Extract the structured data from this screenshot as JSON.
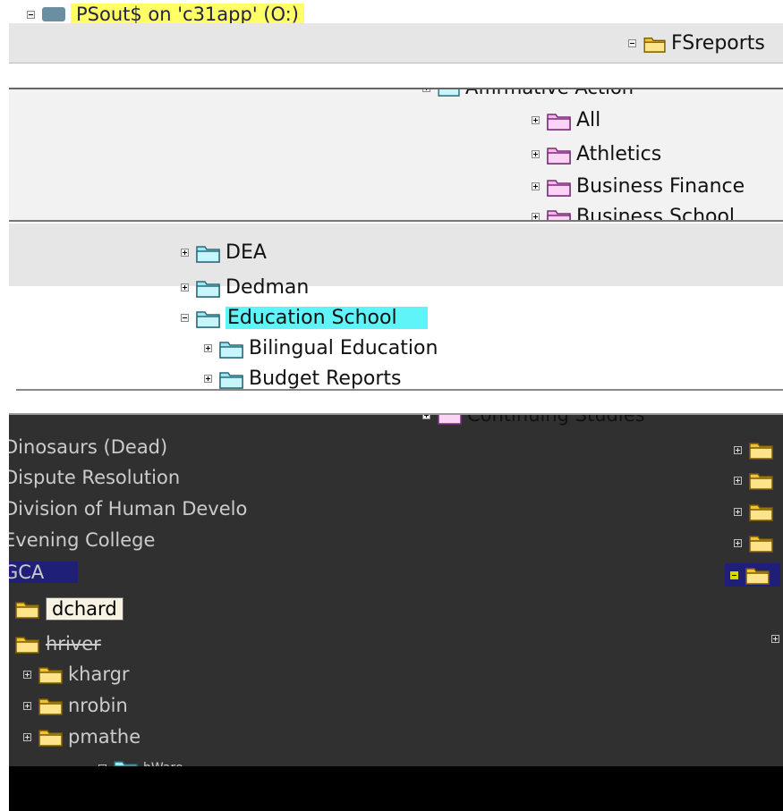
{
  "top_strip": {
    "drive_label": "PSout$ on 'c31app' (O:)"
  },
  "panel_fsreports": {
    "title": "FSreports",
    "items": [
      {
        "label": "Affirmative Action"
      },
      {
        "label": "All"
      },
      {
        "label": "Athletics"
      },
      {
        "label": "Business Finance"
      },
      {
        "label": "Business School"
      }
    ]
  },
  "panel_education": {
    "items": [
      {
        "label": "DEA"
      },
      {
        "label": "Dedman"
      },
      {
        "label": "Education School"
      },
      {
        "label": "Bilingual Education"
      },
      {
        "label": "Budget Reports"
      }
    ]
  },
  "panel_dark": {
    "top_right_label": "Continuing Studies",
    "left_items": [
      {
        "label": "Dinosaurs (Dead)"
      },
      {
        "label": "Dispute Resolution"
      },
      {
        "label": "Division of Human Develo"
      },
      {
        "label": "Evening College"
      },
      {
        "label": "GCA"
      }
    ],
    "sub_items": [
      {
        "label": "dchard"
      },
      {
        "label": "hriver"
      },
      {
        "label": "khargr"
      },
      {
        "label": "nrobin"
      },
      {
        "label": "pmathe"
      },
      {
        "label": "bWare"
      }
    ]
  },
  "colors": {
    "cyan_highlight": "#5ef4f8",
    "navy_highlight": "#1f1f78",
    "pink_folder": "#f5b6ec",
    "teal_folder": "#9be8f2",
    "yellow_folder": "#f1c232"
  }
}
